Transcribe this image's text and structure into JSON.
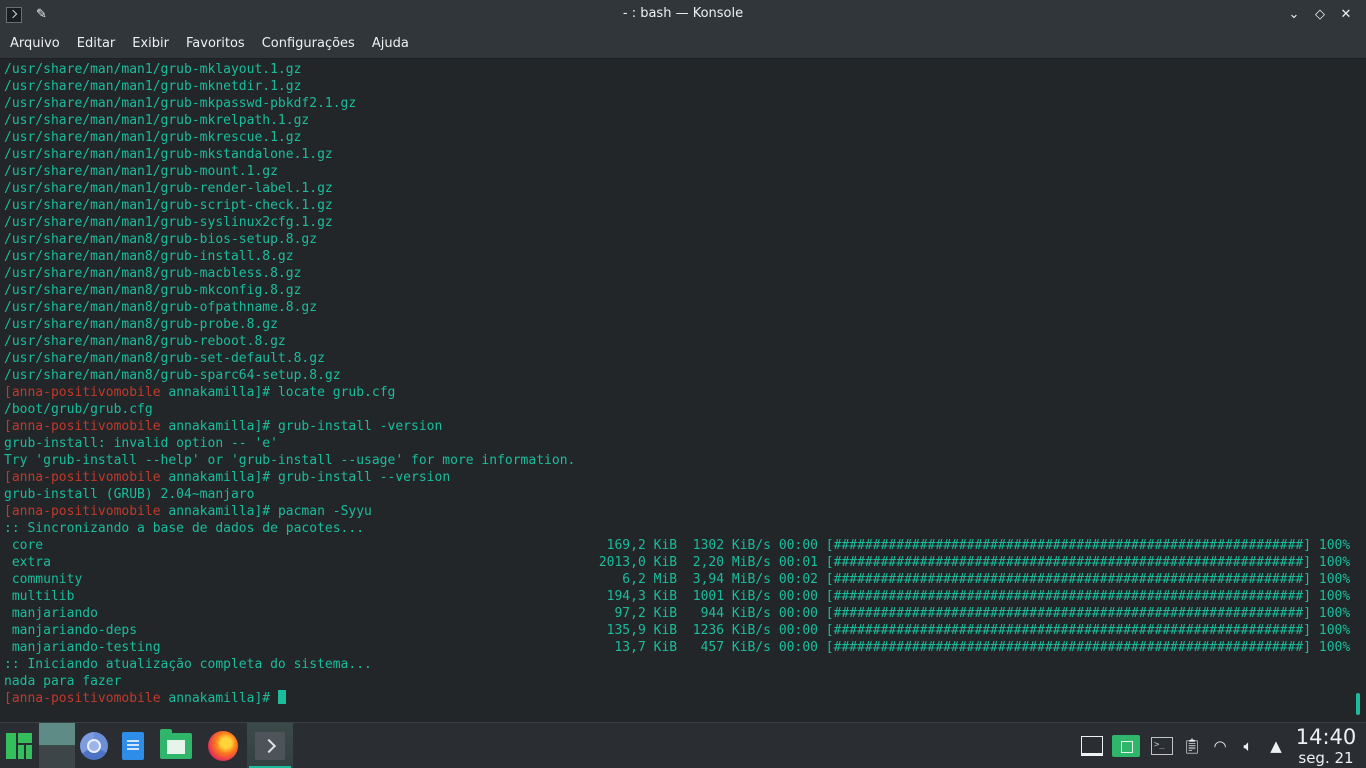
{
  "window": {
    "title": "- : bash — Konsole",
    "icons": {
      "app": "konsole-icon",
      "pin": "pin-icon"
    },
    "controls": {
      "minimize": "⌄",
      "maximize": "◇",
      "close": "✕"
    }
  },
  "menu": {
    "items": [
      "Arquivo",
      "Editar",
      "Exibir",
      "Favoritos",
      "Configurações",
      "Ajuda"
    ]
  },
  "terminal": {
    "prompt_user": "[anna-positivomobile",
    "prompt_dir": " annakamilla]# ",
    "lines": [
      {
        "type": "out",
        "text": "/usr/share/man/man1/grub-mklayout.1.gz"
      },
      {
        "type": "out",
        "text": "/usr/share/man/man1/grub-mknetdir.1.gz"
      },
      {
        "type": "out",
        "text": "/usr/share/man/man1/grub-mkpasswd-pbkdf2.1.gz"
      },
      {
        "type": "out",
        "text": "/usr/share/man/man1/grub-mkrelpath.1.gz"
      },
      {
        "type": "out",
        "text": "/usr/share/man/man1/grub-mkrescue.1.gz"
      },
      {
        "type": "out",
        "text": "/usr/share/man/man1/grub-mkstandalone.1.gz"
      },
      {
        "type": "out",
        "text": "/usr/share/man/man1/grub-mount.1.gz"
      },
      {
        "type": "out",
        "text": "/usr/share/man/man1/grub-render-label.1.gz"
      },
      {
        "type": "out",
        "text": "/usr/share/man/man1/grub-script-check.1.gz"
      },
      {
        "type": "out",
        "text": "/usr/share/man/man1/grub-syslinux2cfg.1.gz"
      },
      {
        "type": "out",
        "text": "/usr/share/man/man8/grub-bios-setup.8.gz"
      },
      {
        "type": "out",
        "text": "/usr/share/man/man8/grub-install.8.gz"
      },
      {
        "type": "out",
        "text": "/usr/share/man/man8/grub-macbless.8.gz"
      },
      {
        "type": "out",
        "text": "/usr/share/man/man8/grub-mkconfig.8.gz"
      },
      {
        "type": "out",
        "text": "/usr/share/man/man8/grub-ofpathname.8.gz"
      },
      {
        "type": "out",
        "text": "/usr/share/man/man8/grub-probe.8.gz"
      },
      {
        "type": "out",
        "text": "/usr/share/man/man8/grub-reboot.8.gz"
      },
      {
        "type": "out",
        "text": "/usr/share/man/man8/grub-set-default.8.gz"
      },
      {
        "type": "out",
        "text": "/usr/share/man/man8/grub-sparc64-setup.8.gz"
      },
      {
        "type": "cmd",
        "text": "locate grub.cfg"
      },
      {
        "type": "out",
        "text": "/boot/grub/grub.cfg"
      },
      {
        "type": "cmd",
        "text": "grub-install -version"
      },
      {
        "type": "out",
        "text": "grub-install: invalid option -- 'e'"
      },
      {
        "type": "out",
        "text": "Try 'grub-install --help' or 'grub-install --usage' for more information."
      },
      {
        "type": "cmd",
        "text": "grub-install --version"
      },
      {
        "type": "out",
        "text": "grub-install (GRUB) 2.04~manjaro"
      },
      {
        "type": "cmd",
        "text": "pacman -Syyu"
      },
      {
        "type": "out",
        "text": ":: Sincronizando a base de dados de pacotes..."
      },
      {
        "type": "out",
        "text": " core                                                                        169,2 KiB  1302 KiB/s 00:00 [############################################################] 100%"
      },
      {
        "type": "out",
        "text": " extra                                                                      2013,0 KiB  2,20 MiB/s 00:01 [############################################################] 100%"
      },
      {
        "type": "out",
        "text": " community                                                                     6,2 MiB  3,94 MiB/s 00:02 [############################################################] 100%"
      },
      {
        "type": "out",
        "text": " multilib                                                                    194,3 KiB  1001 KiB/s 00:00 [############################################################] 100%"
      },
      {
        "type": "out",
        "text": " manjariando                                                                  97,2 KiB   944 KiB/s 00:00 [############################################################] 100%"
      },
      {
        "type": "out",
        "text": " manjariando-deps                                                            135,9 KiB  1236 KiB/s 00:00 [############################################################] 100%"
      },
      {
        "type": "out",
        "text": " manjariando-testing                                                          13,7 KiB   457 KiB/s 00:00 [############################################################] 100%"
      },
      {
        "type": "out",
        "text": ":: Iniciando atualização completa do sistema..."
      },
      {
        "type": "out",
        "text": "nada para fazer"
      },
      {
        "type": "cmd",
        "text": ""
      }
    ]
  },
  "taskbar": {
    "apps": [
      {
        "name": "manjaro-menu-icon"
      },
      {
        "name": "desktop-pager"
      },
      {
        "name": "chromium-icon"
      },
      {
        "name": "document-editor-icon"
      },
      {
        "name": "file-manager-icon"
      },
      {
        "name": "firefox-icon"
      },
      {
        "name": "konsole-icon"
      }
    ],
    "tray": [
      "show-desktop-icon",
      "files-folder-icon",
      "terminal-tray-icon",
      "clipboard-icon",
      "wifi-icon",
      "volume-icon",
      "expand-tray-icon"
    ],
    "clock": {
      "time": "14:40",
      "date": "seg. 21"
    }
  },
  "colors": {
    "terminal_bg": "#232629",
    "terminal_fg": "#1abc9c",
    "prompt_user": "#c0392b",
    "titlebar_bg": "#31363b",
    "taskbar_bg": "#2a2e32"
  }
}
